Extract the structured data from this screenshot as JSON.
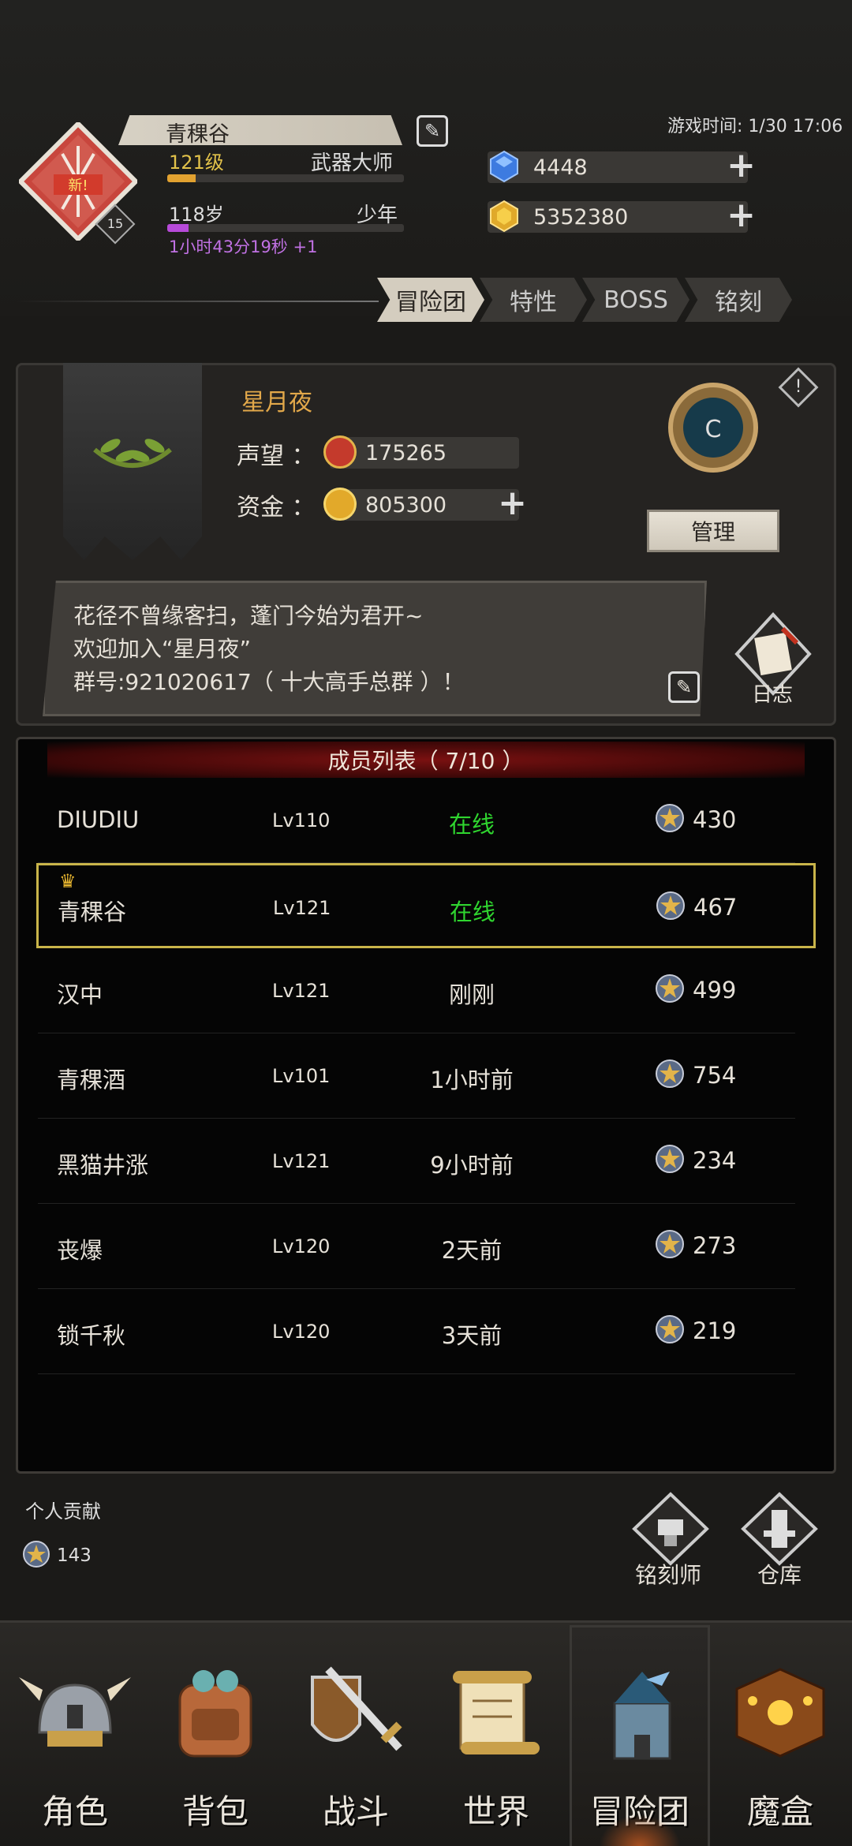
{
  "player": {
    "name": "青稞谷",
    "emblem_label": "新!",
    "emblem_level": "15",
    "level": "121级",
    "class": "武器大师",
    "age": "118岁",
    "age_class": "少年",
    "timer": "1小时43分19秒 +1",
    "level_progress": 0.12,
    "age_progress": 0.09
  },
  "game_time": "游戏时间: 1/30 17:06",
  "currency": {
    "gems": "4448",
    "gold": "5352380"
  },
  "tabs": [
    "冒险团",
    "特性",
    "BOSS",
    "铭刻"
  ],
  "active_tab": "冒险团",
  "guild": {
    "name": "星月夜",
    "reputation_label": "声望 ：",
    "reputation": "175265",
    "funds_label": "资金 ：",
    "funds": "805300",
    "rank": "C",
    "manage_label": "管理",
    "notice": [
      "花径不曾缘客扫，蓬门今始为君开~",
      "欢迎加入“星月夜”",
      "群号:921020617（ 十大高手总群 ）！"
    ],
    "journal_label": "日志"
  },
  "members": {
    "title": "成员列表（ 7/10 ）",
    "rows": [
      {
        "name": "DIUDIU",
        "level": "Lv110",
        "status": "在线",
        "points": "430",
        "online": true,
        "selected": false
      },
      {
        "name": "青稞谷",
        "level": "Lv121",
        "status": "在线",
        "points": "467",
        "online": true,
        "selected": true
      },
      {
        "name": "汉中",
        "level": "Lv121",
        "status": "刚刚",
        "points": "499",
        "online": false,
        "selected": false
      },
      {
        "name": "青稞酒",
        "level": "Lv101",
        "status": "1小时前",
        "points": "754",
        "online": false,
        "selected": false
      },
      {
        "name": "黑猫井涨",
        "level": "Lv121",
        "status": "9小时前",
        "points": "234",
        "online": false,
        "selected": false
      },
      {
        "name": "丧爆",
        "level": "Lv120",
        "status": "2天前",
        "points": "273",
        "online": false,
        "selected": false
      },
      {
        "name": "锁千秋",
        "level": "Lv120",
        "status": "3天前",
        "points": "219",
        "online": false,
        "selected": false
      }
    ]
  },
  "personal": {
    "label": "个人贡献",
    "points": "143"
  },
  "shortcuts": {
    "engraver": "铭刻师",
    "warehouse": "仓库"
  },
  "nav": [
    "角色",
    "背包",
    "战斗",
    "世界",
    "冒险团",
    "魔盒"
  ],
  "active_nav": "冒险团"
}
